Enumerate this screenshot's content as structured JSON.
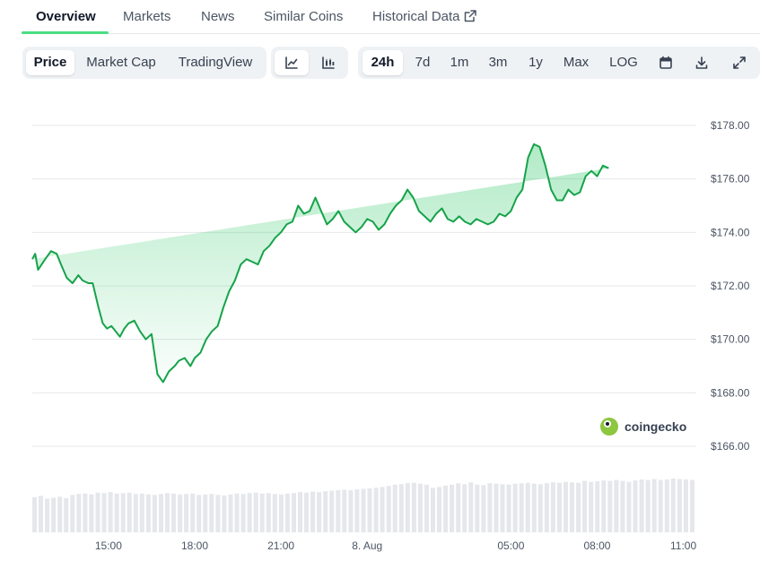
{
  "tabs": [
    {
      "label": "Overview",
      "active": true
    },
    {
      "label": "Markets"
    },
    {
      "label": "News"
    },
    {
      "label": "Similar Coins"
    },
    {
      "label": "Historical Data"
    }
  ],
  "chart_type_buttons": [
    {
      "label": "Price",
      "active": true
    },
    {
      "label": "Market Cap"
    },
    {
      "label": "TradingView"
    }
  ],
  "style_buttons": [
    {
      "icon": "line-chart-icon",
      "active": true
    },
    {
      "icon": "candlestick-icon"
    }
  ],
  "range_buttons": [
    {
      "label": "24h",
      "active": true
    },
    {
      "label": "7d"
    },
    {
      "label": "1m"
    },
    {
      "label": "3m"
    },
    {
      "label": "1y"
    },
    {
      "label": "Max"
    },
    {
      "label": "LOG"
    }
  ],
  "tool_buttons": [
    {
      "icon": "calendar-icon"
    },
    {
      "icon": "download-icon"
    },
    {
      "icon": "fullscreen-icon"
    }
  ],
  "watermark": "coingecko",
  "chart_data": {
    "type": "area",
    "color": "#16a34a",
    "fill_color": "#22c55e",
    "y_ticks": [
      "$178.00",
      "$176.00",
      "$174.00",
      "$172.00",
      "$170.00",
      "$168.00",
      "$166.00"
    ],
    "y_tick_values": [
      178,
      176,
      174,
      172,
      170,
      168,
      166
    ],
    "ylim": [
      166,
      178
    ],
    "x_ticks": [
      "15:00",
      "18:00",
      "21:00",
      "8. Aug",
      "05:00",
      "08:00",
      "11:00"
    ],
    "x_tick_hours": [
      15,
      18,
      21,
      24,
      29,
      32,
      35
    ],
    "xlim": [
      12.35,
      35.45
    ],
    "x_hours": [
      12.35,
      12.45,
      12.55,
      12.8,
      13.0,
      13.2,
      13.35,
      13.55,
      13.75,
      13.95,
      14.1,
      14.3,
      14.45,
      14.65,
      14.8,
      14.95,
      15.1,
      15.25,
      15.4,
      15.55,
      15.7,
      15.9,
      16.1,
      16.3,
      16.5,
      16.7,
      16.9,
      17.1,
      17.3,
      17.45,
      17.65,
      17.85,
      18.0,
      18.2,
      18.4,
      18.6,
      18.8,
      19.0,
      19.2,
      19.4,
      19.6,
      19.8,
      20.0,
      20.2,
      20.4,
      20.6,
      20.8,
      21.0,
      21.2,
      21.4,
      21.6,
      21.8,
      22.0,
      22.2,
      22.4,
      22.6,
      22.8,
      23.0,
      23.2,
      23.4,
      23.6,
      23.8,
      24.0,
      24.2,
      24.4,
      24.6,
      24.8,
      25.0,
      25.2,
      25.4,
      25.6,
      25.8,
      26.0,
      26.2,
      26.4,
      26.6,
      26.8,
      27.0,
      27.2,
      27.4,
      27.6,
      27.8,
      28.0,
      28.2,
      28.4,
      28.6,
      28.8,
      29.0,
      29.2,
      29.4,
      29.6,
      29.8,
      30.0,
      30.2,
      30.4,
      30.6,
      30.8,
      31.0,
      31.2,
      31.4,
      31.6,
      31.8,
      32.0,
      32.2,
      32.4,
      32.6,
      32.8,
      33.0,
      33.2,
      33.4,
      33.6,
      33.8,
      34.0,
      34.2,
      34.4,
      34.6,
      34.8,
      35.0,
      35.2,
      35.4
    ],
    "values": [
      173.0,
      173.2,
      172.6,
      173.0,
      173.3,
      173.2,
      172.8,
      172.3,
      172.1,
      172.4,
      172.2,
      172.1,
      172.1,
      171.2,
      170.6,
      170.4,
      170.5,
      170.3,
      170.1,
      170.4,
      170.6,
      170.7,
      170.3,
      170.0,
      170.2,
      168.7,
      168.4,
      168.8,
      169.0,
      169.2,
      169.3,
      169.0,
      169.3,
      169.5,
      170.0,
      170.3,
      170.5,
      171.2,
      171.8,
      172.2,
      172.8,
      173.0,
      172.9,
      172.8,
      173.3,
      173.5,
      173.8,
      174.0,
      174.3,
      174.4,
      175.0,
      174.7,
      174.8,
      175.3,
      174.8,
      174.3,
      174.5,
      174.8,
      174.4,
      174.2,
      174.0,
      174.2,
      174.5,
      174.4,
      174.1,
      174.3,
      174.7,
      175.0,
      175.2,
      175.6,
      175.3,
      174.8,
      174.6,
      174.4,
      174.7,
      174.9,
      174.5,
      174.4,
      174.6,
      174.4,
      174.3,
      174.5,
      174.4,
      174.3,
      174.4,
      174.7,
      174.6,
      174.8,
      175.3,
      175.6,
      176.8,
      177.3,
      177.2,
      176.5,
      175.6,
      175.2,
      175.2,
      175.6,
      175.4,
      175.5,
      176.1,
      176.3,
      176.1,
      176.5,
      176.4
    ],
    "volume_heights": [
      0.75,
      0.78,
      0.72,
      0.74,
      0.76,
      0.73,
      0.8,
      0.82,
      0.83,
      0.81,
      0.85,
      0.84,
      0.86,
      0.83,
      0.84,
      0.85,
      0.82,
      0.83,
      0.81,
      0.8,
      0.82,
      0.84,
      0.83,
      0.81,
      0.82,
      0.83,
      0.8,
      0.81,
      0.82,
      0.8,
      0.79,
      0.81,
      0.83,
      0.82,
      0.84,
      0.85,
      0.83,
      0.84,
      0.82,
      0.81,
      0.83,
      0.84,
      0.86,
      0.85,
      0.87,
      0.86,
      0.88,
      0.89,
      0.9,
      0.91,
      0.9,
      0.92,
      0.93,
      0.94,
      0.95,
      0.97,
      0.99,
      1.02,
      1.03,
      1.05,
      1.06,
      1.04,
      1.02,
      0.95,
      0.97,
      1.0,
      1.02,
      1.05,
      1.03,
      1.07,
      1.02,
      1.01,
      1.05,
      1.04,
      1.03,
      1.02,
      1.04,
      1.05,
      1.06,
      1.04,
      1.03,
      1.05,
      1.07,
      1.06,
      1.08,
      1.07,
      1.06,
      1.1,
      1.08,
      1.09,
      1.11,
      1.1,
      1.12,
      1.1,
      1.08,
      1.11,
      1.13,
      1.12,
      1.14,
      1.12,
      1.13,
      1.15,
      1.14,
      1.13,
      1.12
    ]
  }
}
